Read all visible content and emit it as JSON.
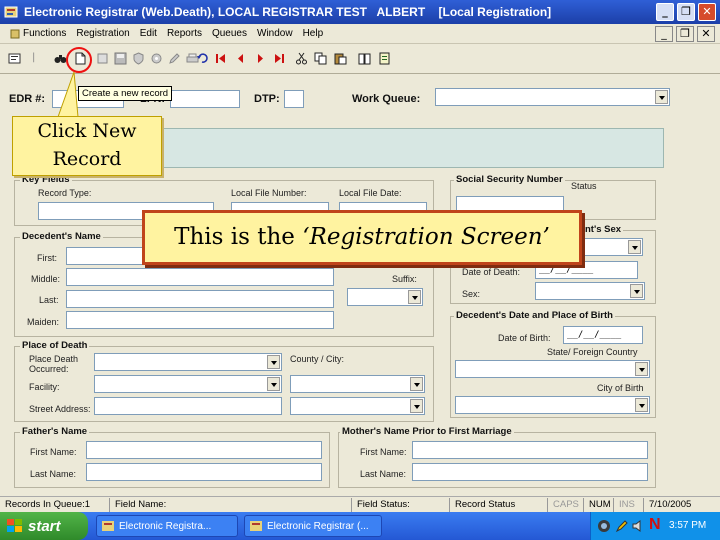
{
  "window": {
    "title": "Electronic Registrar (Web.Death), LOCAL REGISTRAR TEST   ALBERT    [Local Registration]",
    "minimize_label": "_",
    "restore_label": "❐",
    "close_label": "✕"
  },
  "menu": {
    "items": [
      "Functions",
      "Registration",
      "Edit",
      "Reports",
      "Queues",
      "Window",
      "Help"
    ],
    "mdi_minimize": "_",
    "mdi_restore": "❐",
    "mdi_close": "✕"
  },
  "toolbar": {
    "tooltip": "Create a new record",
    "icons": [
      "binoculars-icon",
      "new-record-icon",
      "open-icon",
      "save-icon",
      "shield-icon",
      "gear-icon",
      "edit-icon",
      "print-icon",
      "refresh-icon",
      "first-record-icon",
      "previous-record-icon",
      "next-record-icon",
      "last-record-icon",
      "cut-icon",
      "copy-icon",
      "paste-icon",
      "book-icon",
      "notes-icon"
    ]
  },
  "header": {
    "edr_label": "EDR #:",
    "lfn_label": "LFN:",
    "dtp_label": "DTP:",
    "work_queue_label": "Work Queue:",
    "work_queue_value": ""
  },
  "sections": {
    "key_fields": {
      "title": "Key Fields",
      "record_type_label": "Record Type:",
      "local_file_number_label": "Local File Number:",
      "local_file_date_label": "Local File Date:"
    },
    "ssn": {
      "title": "Social Security Number",
      "status_label": "Status"
    },
    "decedent_name": {
      "title": "Decedent's Name",
      "first_label": "First:",
      "middle_label": "Middle:",
      "last_label": "Last:",
      "suffix_label": "Suffix:",
      "maiden_label": "Maiden:"
    },
    "decedent_sex": {
      "title_partial": "nt's Sex",
      "date_of_death_label": "Date of Death:",
      "date_of_death_value": "__/__/____",
      "sex_label": "Sex:"
    },
    "date_place_birth": {
      "title": "Decedent's Date and Place of Birth",
      "date_of_birth_label": "Date of Birth:",
      "date_of_birth_value": "__/__/____",
      "state_label": "State/ Foreign Country",
      "city_label": "City of Birth"
    },
    "place_of_death": {
      "title": "Place of Death",
      "place_death_label": "Place Death Occurred:",
      "facility_label": "Facility:",
      "street_label": "Street Address:",
      "county_label": "County / City:"
    },
    "father": {
      "title": "Father's Name",
      "first_label": "First Name:",
      "last_label": "Last Name:"
    },
    "mother": {
      "title": "Mother's Name Prior to First Marriage",
      "first_label": "First Name:",
      "last_label": "Last Name:"
    }
  },
  "status_bar": {
    "records": "Records In Queue:1",
    "field_name": "Field Name:",
    "field_status": "Field Status:",
    "record_status": "Record Status",
    "caps": "CAPS",
    "num": "NUM",
    "ins": "INS",
    "date": "7/10/2005"
  },
  "taskbar": {
    "start": "start",
    "tasks": [
      "Electronic Registra...",
      "Electronic Registrar (..."
    ],
    "tray_flag": "N",
    "time": "3:57 PM"
  },
  "callouts": {
    "click_new": "Click New\nRecord",
    "screen_prefix": "This is the ",
    "screen_name": "‘Registration Screen’"
  },
  "colors": {
    "titlebar": "#1c3fa8",
    "window_bg": "#ece9d8",
    "highlight": "#e11111",
    "callout_fill": "#fff3a0",
    "callout_border": "#c0441a"
  }
}
